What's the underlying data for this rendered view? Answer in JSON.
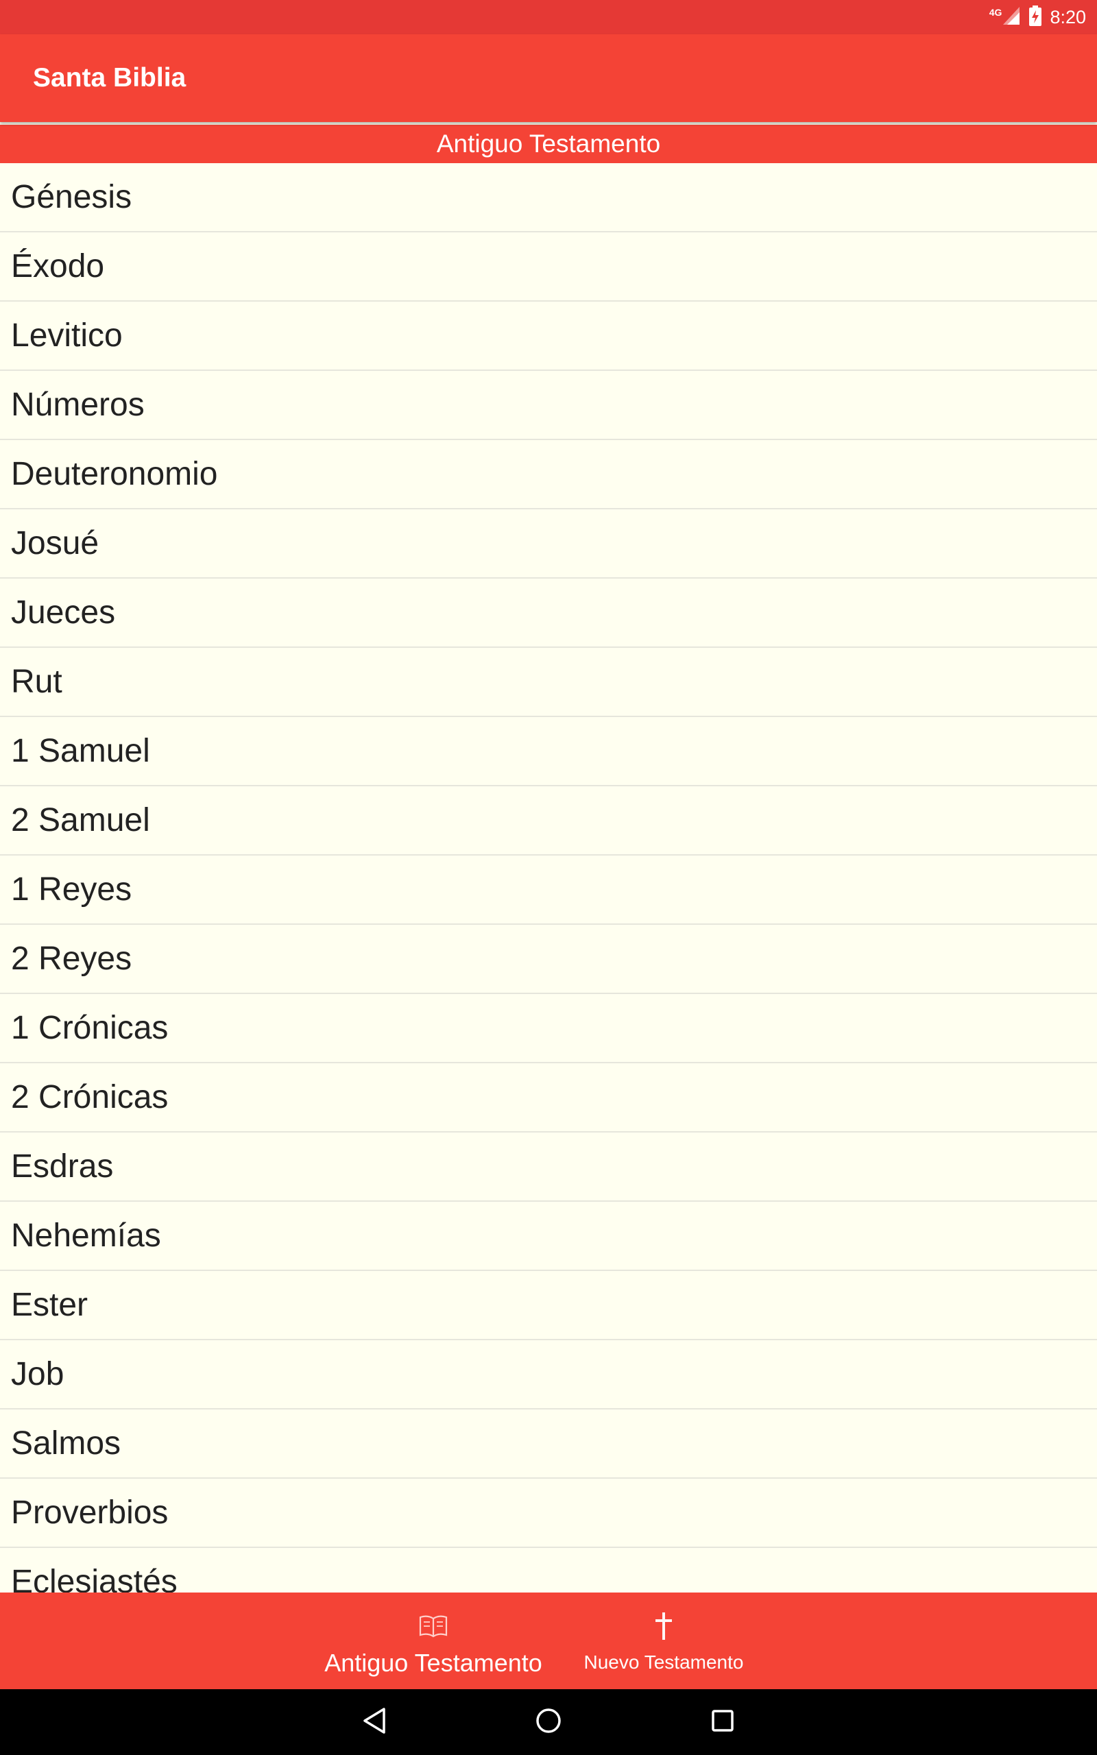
{
  "status_bar": {
    "network": "4G",
    "time": "8:20"
  },
  "app_bar": {
    "title": "Santa Biblia"
  },
  "section": {
    "title": "Antiguo Testamento"
  },
  "books": [
    "Génesis",
    "Éxodo",
    "Levitico",
    "Números",
    "Deuteronomio",
    "Josué",
    "Jueces",
    "Rut",
    "1 Samuel",
    "2 Samuel",
    "1 Reyes",
    "2 Reyes",
    "1 Crónicas",
    "2 Crónicas",
    "Esdras",
    "Nehemías",
    "Ester",
    "Job",
    "Salmos",
    "Proverbios",
    "Eclesiastés"
  ],
  "bottom_nav": {
    "tabs": [
      {
        "label": "Antiguo Testamento",
        "icon": "open-book-icon",
        "active": true
      },
      {
        "label": "Nuevo Testamento",
        "icon": "cross-icon",
        "active": false
      }
    ]
  },
  "colors": {
    "status_bar": "#e53935",
    "primary": "#f44336",
    "list_background": "#fffff0",
    "divider": "#e6e6dc",
    "text": "#222222"
  }
}
